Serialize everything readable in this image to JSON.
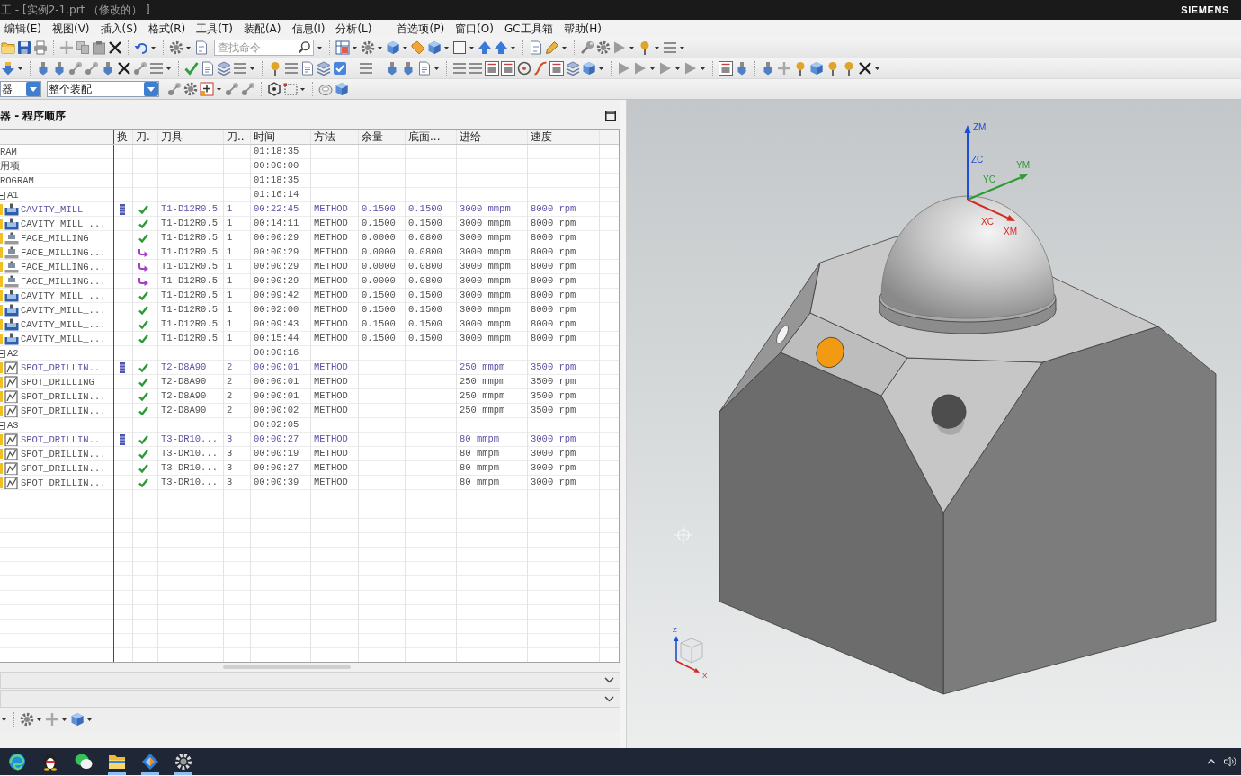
{
  "title_bar": {
    "title": "工 - [实例2-1.prt （修改的） ]",
    "brand": "SIEMENS"
  },
  "menu_bar": {
    "items": [
      "编辑(E)",
      "视图(V)",
      "插入(S)",
      "格式(R)",
      "工具(T)",
      "装配(A)",
      "信息(I)",
      "分析(L)",
      "首选项(P)",
      "窗口(O)",
      "GC工具箱",
      "帮助(H)"
    ]
  },
  "toolbar": {
    "search": {
      "placeholder": "查找命令"
    },
    "filter_dropdown": {
      "value": "器"
    },
    "scope_dropdown": {
      "value": "整个装配"
    }
  },
  "navigator": {
    "title": "器 - 程序顺序",
    "columns": [
      "换",
      "刀.",
      "刀具",
      "刀..",
      "时间",
      "方法",
      "余量",
      "底面...",
      "进给",
      "速度"
    ],
    "rows": [
      {
        "column_1": "RAM",
        "kind": "program",
        "time": "01:18:35",
        "children": [
          {
            "column_1": "用项",
            "kind": "program",
            "time": "00:00:00"
          },
          {
            "column_1": "ROGRAM",
            "kind": "program",
            "time": "01:18:35",
            "children": [
              {
                "column_1": "A1",
                "kind": "group",
                "expanded": true,
                "time": "01:16:14",
                "children": [
                  {
                    "column_1": "CAVITY_MILL",
                    "kind": "cavity_mill",
                    "tool_change": true,
                    "column_3_ok": true,
                    "tool": "T1-D12R0.5",
                    "column_5": "1",
                    "time": "00:22:45",
                    "method": "METHOD",
                    "stock": "0.1500",
                    "column_9": "0.1500",
                    "feed": "3000 mmpm",
                    "speed": "8000 rpm"
                  },
                  {
                    "column_1": "CAVITY_MILL_...",
                    "kind": "cavity_mill",
                    "tool_change": false,
                    "column_3_ok": true,
                    "tool": "T1-D12R0.5",
                    "column_5": "1",
                    "time": "00:14:11",
                    "method": "METHOD",
                    "stock": "0.1500",
                    "column_9": "0.1500",
                    "feed": "3000 mmpm",
                    "speed": "8000 rpm"
                  },
                  {
                    "column_1": "FACE_MILLING",
                    "kind": "face_milling",
                    "tool_change": false,
                    "column_3_ok": true,
                    "tool": "T1-D12R0.5",
                    "column_5": "1",
                    "time": "00:00:29",
                    "method": "METHOD",
                    "stock": "0.0000",
                    "column_9": "0.0800",
                    "feed": "3000 mmpm",
                    "speed": "8000 rpm"
                  },
                  {
                    "column_1": "FACE_MILLING...",
                    "kind": "face_milling",
                    "tool_change": false,
                    "column_3_ok": false,
                    "tool": "T1-D12R0.5",
                    "column_5": "1",
                    "time": "00:00:29",
                    "method": "METHOD",
                    "stock": "0.0000",
                    "column_9": "0.0800",
                    "feed": "3000 mmpm",
                    "speed": "8000 rpm"
                  },
                  {
                    "column_1": "FACE_MILLING...",
                    "kind": "face_milling",
                    "tool_change": false,
                    "column_3_ok": false,
                    "tool": "T1-D12R0.5",
                    "column_5": "1",
                    "time": "00:00:29",
                    "method": "METHOD",
                    "stock": "0.0000",
                    "column_9": "0.0800",
                    "feed": "3000 mmpm",
                    "speed": "8000 rpm"
                  },
                  {
                    "column_1": "FACE_MILLING...",
                    "kind": "face_milling",
                    "tool_change": false,
                    "column_3_ok": false,
                    "tool": "T1-D12R0.5",
                    "column_5": "1",
                    "time": "00:00:29",
                    "method": "METHOD",
                    "stock": "0.0000",
                    "column_9": "0.0800",
                    "feed": "3000 mmpm",
                    "speed": "8000 rpm"
                  },
                  {
                    "column_1": "CAVITY_MILL_...",
                    "kind": "cavity_mill",
                    "tool_change": false,
                    "column_3_ok": true,
                    "tool": "T1-D12R0.5",
                    "column_5": "1",
                    "time": "00:09:42",
                    "method": "METHOD",
                    "stock": "0.1500",
                    "column_9": "0.1500",
                    "feed": "3000 mmpm",
                    "speed": "8000 rpm"
                  },
                  {
                    "column_1": "CAVITY_MILL_...",
                    "kind": "cavity_mill",
                    "tool_change": false,
                    "column_3_ok": true,
                    "tool": "T1-D12R0.5",
                    "column_5": "1",
                    "time": "00:02:00",
                    "method": "METHOD",
                    "stock": "0.1500",
                    "column_9": "0.1500",
                    "feed": "3000 mmpm",
                    "speed": "8000 rpm"
                  },
                  {
                    "column_1": "CAVITY_MILL_...",
                    "kind": "cavity_mill",
                    "tool_change": false,
                    "column_3_ok": true,
                    "tool": "T1-D12R0.5",
                    "column_5": "1",
                    "time": "00:09:43",
                    "method": "METHOD",
                    "stock": "0.1500",
                    "column_9": "0.1500",
                    "feed": "3000 mmpm",
                    "speed": "8000 rpm"
                  },
                  {
                    "column_1": "CAVITY_MILL_...",
                    "kind": "cavity_mill",
                    "tool_change": false,
                    "column_3_ok": true,
                    "tool": "T1-D12R0.5",
                    "column_5": "1",
                    "time": "00:15:44",
                    "method": "METHOD",
                    "stock": "0.1500",
                    "column_9": "0.1500",
                    "feed": "3000 mmpm",
                    "speed": "8000 rpm"
                  }
                ]
              },
              {
                "column_1": "A2",
                "kind": "group",
                "expanded": true,
                "time": "00:00:16",
                "children": [
                  {
                    "column_1": "SPOT_DRILLIN...",
                    "kind": "spot_drilling",
                    "tool_change": true,
                    "column_3_ok": true,
                    "tool": "T2-D8A90",
                    "column_5": "2",
                    "time": "00:00:01",
                    "method": "METHOD",
                    "feed": "250 mmpm",
                    "speed": "3500 rpm"
                  },
                  {
                    "column_1": "SPOT_DRILLING",
                    "kind": "spot_drilling",
                    "tool_change": false,
                    "column_3_ok": true,
                    "tool": "T2-D8A90",
                    "column_5": "2",
                    "time": "00:00:01",
                    "method": "METHOD",
                    "feed": "250 mmpm",
                    "speed": "3500 rpm"
                  },
                  {
                    "column_1": "SPOT_DRILLIN...",
                    "kind": "spot_drilling",
                    "tool_change": false,
                    "column_3_ok": true,
                    "tool": "T2-D8A90",
                    "column_5": "2",
                    "time": "00:00:01",
                    "method": "METHOD",
                    "feed": "250 mmpm",
                    "speed": "3500 rpm"
                  },
                  {
                    "column_1": "SPOT_DRILLIN...",
                    "kind": "spot_drilling",
                    "tool_change": false,
                    "column_3_ok": true,
                    "tool": "T2-D8A90",
                    "column_5": "2",
                    "time": "00:00:02",
                    "method": "METHOD",
                    "feed": "250 mmpm",
                    "speed": "3500 rpm"
                  }
                ]
              },
              {
                "column_1": "A3",
                "kind": "group",
                "expanded": true,
                "time": "00:02:05",
                "children": [
                  {
                    "column_1": "SPOT_DRILLIN...",
                    "kind": "spot_drilling",
                    "tool_change": true,
                    "column_3_ok": true,
                    "tool": "T3-DR10...",
                    "column_5": "3",
                    "time": "00:00:27",
                    "method": "METHOD",
                    "feed": "80 mmpm",
                    "speed": "3000 rpm"
                  },
                  {
                    "column_1": "SPOT_DRILLIN...",
                    "kind": "spot_drilling",
                    "tool_change": false,
                    "column_3_ok": true,
                    "tool": "T3-DR10...",
                    "column_5": "3",
                    "time": "00:00:19",
                    "method": "METHOD",
                    "feed": "80 mmpm",
                    "speed": "3000 rpm"
                  },
                  {
                    "column_1": "SPOT_DRILLIN...",
                    "kind": "spot_drilling",
                    "tool_change": false,
                    "column_3_ok": true,
                    "tool": "T3-DR10...",
                    "column_5": "3",
                    "time": "00:00:27",
                    "method": "METHOD",
                    "feed": "80 mmpm",
                    "speed": "3000 rpm"
                  },
                  {
                    "column_1": "SPOT_DRILLIN...",
                    "kind": "spot_drilling",
                    "tool_change": false,
                    "column_3_ok": true,
                    "tool": "T3-DR10...",
                    "column_5": "3",
                    "time": "00:00:39",
                    "method": "METHOD",
                    "feed": "80 mmpm",
                    "speed": "3000 rpm"
                  }
                ]
              }
            ]
          }
        ]
      }
    ]
  },
  "view": {
    "wcs_axes": [
      {
        "kind": "z",
        "labels": [
          "ZM",
          "ZC"
        ]
      },
      {
        "kind": "y",
        "labels": [
          "YC",
          "YM"
        ]
      },
      {
        "kind": "x",
        "labels": [
          "XC",
          "XM"
        ]
      }
    ],
    "triad_axes": [
      {
        "kind": "z",
        "label": "Z"
      },
      {
        "kind": "x",
        "label": "X"
      }
    ]
  },
  "taskbar": {
    "apps": [
      {
        "kind": "browser",
        "running": false
      },
      {
        "kind": "penguin",
        "running": false
      },
      {
        "kind": "chat",
        "running": false
      },
      {
        "kind": "folder",
        "running": true
      },
      {
        "kind": "cad",
        "running": true
      },
      {
        "kind": "utility",
        "running": true
      }
    ]
  }
}
